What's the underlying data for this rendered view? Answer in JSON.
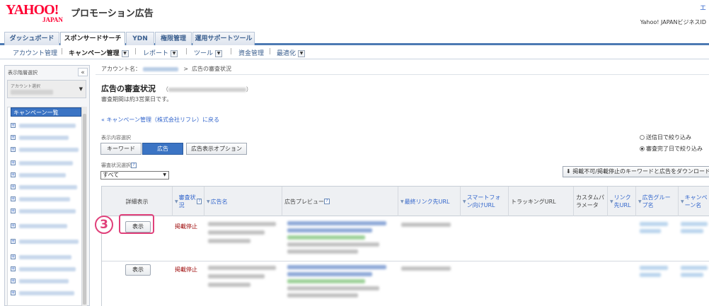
{
  "header": {
    "logo_main": "YAHOO!",
    "logo_sub": "JAPAN",
    "app_title": "プロモーション広告",
    "top_right": "エ",
    "business_id": "Yahoo! JAPANビジネスID"
  },
  "main_tabs": [
    {
      "label": "ダッシュボード"
    },
    {
      "label": "スポンサードサーチ"
    },
    {
      "label": "YDN"
    },
    {
      "label": "権限管理"
    },
    {
      "label": "運用サポートツール"
    }
  ],
  "sub_nav": [
    {
      "label": "アカウント管理"
    },
    {
      "label": "キャンペーン管理"
    },
    {
      "label": "レポート"
    },
    {
      "label": "ツール"
    },
    {
      "label": "資金管理"
    },
    {
      "label": "最適化"
    }
  ],
  "sidebar": {
    "title": "表示階層選択",
    "collapse": "«",
    "account_label": "アカウント選択",
    "list_head": "キャンペーン一覧",
    "expand_glyph": "+"
  },
  "breadcrumb": {
    "prefix": "アカウント名：",
    "separator": ">",
    "current": "広告の審査状況"
  },
  "page": {
    "title": "広告の審査状況",
    "paren_open": "（",
    "paren_close": "）",
    "period_note": "審査期間は約3営業日です。",
    "back_link": "« キャンペーン管理（株式会社リフレ）に戻る"
  },
  "content_type": {
    "label": "表示内容選択",
    "buttons": [
      "キーワード",
      "広告",
      "広告表示オプション"
    ]
  },
  "filters": {
    "radio_sent": "送信日で絞り込み",
    "radio_done": "審査完了日で絞り込み"
  },
  "status_filter": {
    "label": "審査状況選択",
    "help": "?",
    "value": "すべて"
  },
  "download": {
    "label": "⬇ 掲載不可/掲載停止のキーワードと広告をダウンロード"
  },
  "table": {
    "headers": {
      "detail": "詳細表示",
      "status": "審査状況",
      "ad_name": "広告名",
      "preview": "広告プレビュー",
      "final_url": "最終リンク先URL",
      "sp_url": "スマートフォン向けURL",
      "tracking": "トラッキングURL",
      "custom": "カスタムパラメータ",
      "link_url": "リンク先URL",
      "adgroup": "広告グループ名",
      "campaign": "キャンペーン名"
    },
    "rows": [
      {
        "button": "表示",
        "status": "掲載停止"
      },
      {
        "button": "表示",
        "status": "掲載停止"
      }
    ]
  },
  "annotation": {
    "step": "3"
  },
  "colors": {
    "brand_red": "#ff0033",
    "tab_blue": "#4d7ab3",
    "active_blue": "#3b74c4",
    "status_red": "#a01010",
    "highlight_pink": "#e0407a"
  }
}
